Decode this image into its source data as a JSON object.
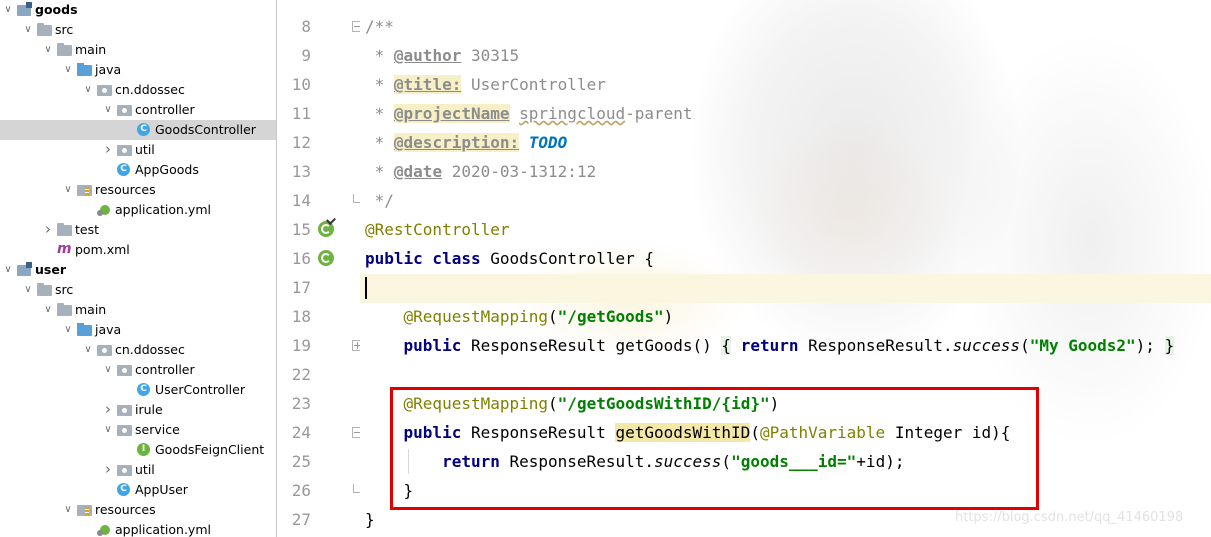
{
  "project_tree": {
    "items": [
      {
        "label": "goods",
        "icon": "module-icon",
        "depth": 0,
        "arrow": "expanded",
        "bold": true
      },
      {
        "label": "src",
        "icon": "folder-icon",
        "depth": 1,
        "arrow": "expanded"
      },
      {
        "label": "main",
        "icon": "folder-icon",
        "depth": 2,
        "arrow": "expanded"
      },
      {
        "label": "java",
        "icon": "source-folder-icon",
        "depth": 3,
        "arrow": "expanded"
      },
      {
        "label": "cn.ddossec",
        "icon": "package-icon",
        "depth": 4,
        "arrow": "expanded"
      },
      {
        "label": "controller",
        "icon": "package-icon",
        "depth": 5,
        "arrow": "expanded"
      },
      {
        "label": "GoodsController",
        "icon": "class-icon",
        "depth": 6,
        "arrow": "none",
        "selected": true
      },
      {
        "label": "util",
        "icon": "package-icon",
        "depth": 5,
        "arrow": "collapsed"
      },
      {
        "label": "AppGoods",
        "icon": "spring-boot-class-icon",
        "depth": 5,
        "arrow": "none"
      },
      {
        "label": "resources",
        "icon": "resources-folder-icon",
        "depth": 3,
        "arrow": "expanded"
      },
      {
        "label": "application.yml",
        "icon": "yml-file-icon",
        "depth": 4,
        "arrow": "none"
      },
      {
        "label": "test",
        "icon": "folder-icon",
        "depth": 2,
        "arrow": "collapsed"
      },
      {
        "label": "pom.xml",
        "icon": "maven-icon",
        "depth": 2,
        "arrow": "none"
      },
      {
        "label": "user",
        "icon": "module-icon",
        "depth": 0,
        "arrow": "expanded",
        "bold": true
      },
      {
        "label": "src",
        "icon": "folder-icon",
        "depth": 1,
        "arrow": "expanded"
      },
      {
        "label": "main",
        "icon": "folder-icon",
        "depth": 2,
        "arrow": "expanded"
      },
      {
        "label": "java",
        "icon": "source-folder-icon",
        "depth": 3,
        "arrow": "expanded"
      },
      {
        "label": "cn.ddossec",
        "icon": "package-icon",
        "depth": 4,
        "arrow": "expanded"
      },
      {
        "label": "controller",
        "icon": "package-icon",
        "depth": 5,
        "arrow": "expanded"
      },
      {
        "label": "UserController",
        "icon": "class-icon",
        "depth": 6,
        "arrow": "none"
      },
      {
        "label": "irule",
        "icon": "package-icon",
        "depth": 5,
        "arrow": "collapsed"
      },
      {
        "label": "service",
        "icon": "package-icon",
        "depth": 5,
        "arrow": "expanded"
      },
      {
        "label": "GoodsFeignClient",
        "icon": "interface-icon",
        "depth": 6,
        "arrow": "none"
      },
      {
        "label": "util",
        "icon": "package-icon",
        "depth": 5,
        "arrow": "collapsed"
      },
      {
        "label": "AppUser",
        "icon": "spring-boot-class-icon",
        "depth": 5,
        "arrow": "none"
      },
      {
        "label": "resources",
        "icon": "resources-folder-icon",
        "depth": 3,
        "arrow": "expanded"
      },
      {
        "label": "application.yml",
        "icon": "yml-file-icon",
        "depth": 4,
        "arrow": "none"
      }
    ]
  },
  "editor": {
    "file": "GoodsController",
    "current_line": "17",
    "lines": [
      {
        "no": "8",
        "segs": [
          [
            "comment",
            "/**"
          ]
        ]
      },
      {
        "no": "9",
        "segs": [
          [
            "comment",
            " * "
          ],
          [
            "tag",
            "@author"
          ],
          [
            "comment",
            " 30315"
          ]
        ]
      },
      {
        "no": "10",
        "segs": [
          [
            "comment",
            " * "
          ],
          [
            "tag tag-bg",
            "@title:"
          ],
          [
            "comment",
            " UserController"
          ]
        ]
      },
      {
        "no": "11",
        "segs": [
          [
            "comment",
            " * "
          ],
          [
            "tag tag-bg",
            "@projectName"
          ],
          [
            "comment",
            " "
          ],
          [
            "comment squig",
            "springcloud"
          ],
          [
            "comment",
            "-parent"
          ]
        ]
      },
      {
        "no": "12",
        "segs": [
          [
            "comment",
            " * "
          ],
          [
            "tag tag-bg",
            "@description:"
          ],
          [
            "comment",
            " "
          ],
          [
            "todo",
            "TODO"
          ]
        ]
      },
      {
        "no": "13",
        "segs": [
          [
            "comment",
            " * "
          ],
          [
            "tag",
            "@date"
          ],
          [
            "comment",
            " 2020-03-1312:12"
          ]
        ]
      },
      {
        "no": "14",
        "segs": [
          [
            "comment",
            " */"
          ]
        ]
      },
      {
        "no": "15",
        "segs": [
          [
            "anno",
            "@RestController"
          ]
        ]
      },
      {
        "no": "16",
        "segs": [
          [
            "kw",
            "public class"
          ],
          [
            "",
            " GoodsController {"
          ]
        ]
      },
      {
        "no": "17",
        "segs": [
          [
            "",
            ""
          ]
        ]
      },
      {
        "no": "18",
        "segs": [
          [
            "",
            "    "
          ],
          [
            "anno",
            "@RequestMapping"
          ],
          [
            "",
            "("
          ],
          [
            "str",
            "\"/getGoods\""
          ],
          [
            "",
            ")"
          ]
        ]
      },
      {
        "no": "19",
        "segs": [
          [
            "",
            "    "
          ],
          [
            "kw",
            "public"
          ],
          [
            "",
            " ResponseResult getGoods() "
          ],
          [
            "brace-hl",
            "{"
          ],
          [
            "",
            " "
          ],
          [
            "kw",
            "return"
          ],
          [
            "",
            " ResponseResult."
          ],
          [
            "italic",
            "success"
          ],
          [
            "",
            "("
          ],
          [
            "str",
            "\"My Goods2\""
          ],
          [
            "",
            "); "
          ],
          [
            "brace-hl",
            "}"
          ]
        ]
      },
      {
        "no": "22",
        "segs": [
          [
            "",
            ""
          ]
        ]
      },
      {
        "no": "23",
        "segs": [
          [
            "",
            "    "
          ],
          [
            "anno",
            "@RequestMapping"
          ],
          [
            "",
            "("
          ],
          [
            "str",
            "\"/getGoodsWithID/{id}\""
          ],
          [
            "",
            ")"
          ]
        ]
      },
      {
        "no": "24",
        "segs": [
          [
            "",
            "    "
          ],
          [
            "kw",
            "public"
          ],
          [
            "",
            " ResponseResult "
          ],
          [
            "method-hl",
            "getGoodsWithID"
          ],
          [
            "",
            "("
          ],
          [
            "anno",
            "@PathVariable"
          ],
          [
            "",
            " Integer id){"
          ]
        ]
      },
      {
        "no": "25",
        "segs": [
          [
            "",
            "        "
          ],
          [
            "kw",
            "return"
          ],
          [
            "",
            " ResponseResult."
          ],
          [
            "italic",
            "success"
          ],
          [
            "",
            "("
          ],
          [
            "str",
            "\"goods___id=\""
          ],
          [
            "",
            "+id);"
          ]
        ]
      },
      {
        "no": "26",
        "segs": [
          [
            "",
            "    }"
          ]
        ]
      },
      {
        "no": "27",
        "segs": [
          [
            "",
            "}"
          ]
        ]
      }
    ]
  },
  "gutter_icons": [
    {
      "line": "15",
      "icon": "spring-bean-checked-icon"
    },
    {
      "line": "16",
      "icon": "spring-bean-icon"
    }
  ],
  "colors": {
    "highlight_box": "#e00000",
    "keyword": "#000080",
    "string": "#008000",
    "annotation": "#808000",
    "comment": "#8c8c8c",
    "todo": "#0073bf"
  },
  "watermark": "https://blog.csdn.net/qq_41460198"
}
